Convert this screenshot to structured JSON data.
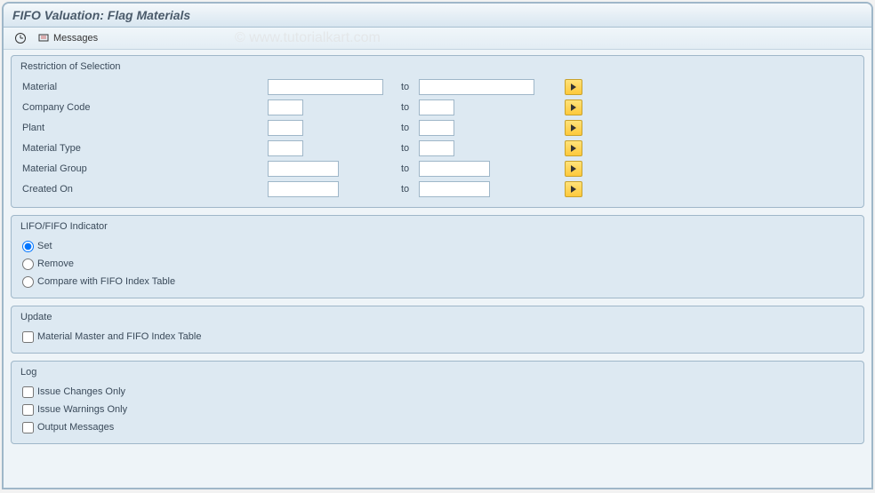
{
  "title": "FIFO Valuation: Flag Materials",
  "toolbar": {
    "execute_tooltip": "Execute",
    "messages_label": "Messages"
  },
  "watermark": "© www.tutorialkart.com",
  "groups": {
    "restriction": {
      "title": "Restriction of Selection",
      "rows": {
        "material": {
          "label": "Material",
          "from": "",
          "to": "",
          "to_label": "to"
        },
        "company_code": {
          "label": "Company Code",
          "from": "",
          "to": "",
          "to_label": "to"
        },
        "plant": {
          "label": "Plant",
          "from": "",
          "to": "",
          "to_label": "to"
        },
        "material_type": {
          "label": "Material Type",
          "from": "",
          "to": "",
          "to_label": "to"
        },
        "material_group": {
          "label": "Material Group",
          "from": "",
          "to": "",
          "to_label": "to"
        },
        "created_on": {
          "label": "Created On",
          "from": "",
          "to": "",
          "to_label": "to"
        }
      }
    },
    "indicator": {
      "title": "LIFO/FIFO Indicator",
      "options": {
        "set": "Set",
        "remove": "Remove",
        "compare": "Compare with FIFO Index Table"
      },
      "selected": "set"
    },
    "update": {
      "title": "Update",
      "options": {
        "master_index": "Material Master and FIFO Index Table"
      }
    },
    "log": {
      "title": "Log",
      "options": {
        "issue_changes": "Issue Changes Only",
        "issue_warnings": "Issue Warnings Only",
        "output_messages": "Output Messages"
      }
    }
  }
}
